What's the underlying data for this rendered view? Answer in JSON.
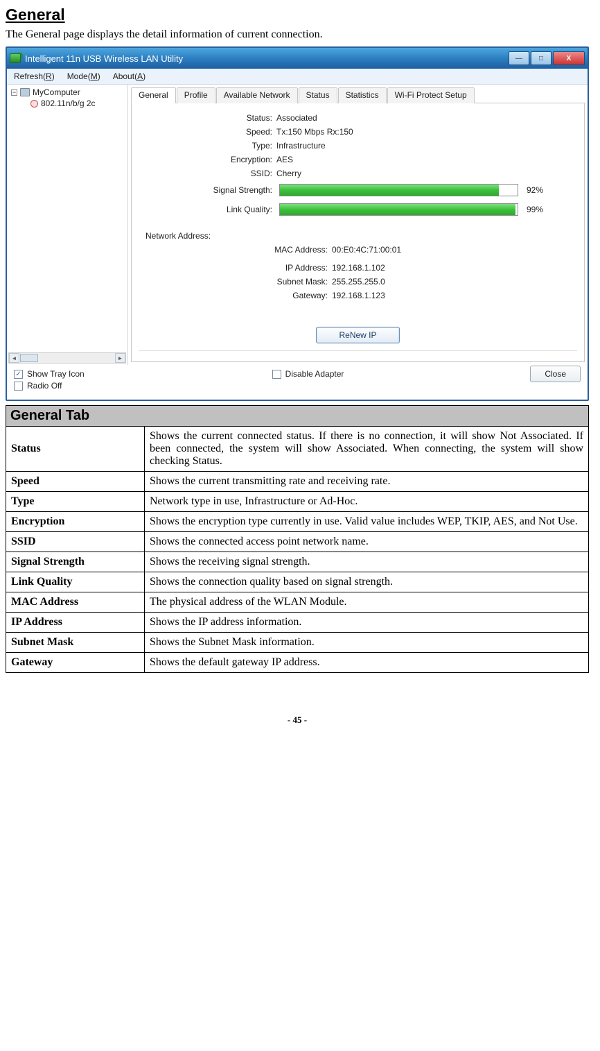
{
  "page": {
    "title": "General",
    "intro": "The General page displays the detail information of current connection.",
    "page_number": "- 45 -"
  },
  "window": {
    "title": "Intelligent 11n USB Wireless LAN Utility",
    "minimize_glyph": "—",
    "maximize_glyph": "□",
    "close_glyph": "X"
  },
  "menu": {
    "refresh": "Refresh(R)",
    "mode": "Mode(M)",
    "about": "About(A)"
  },
  "tree": {
    "root": "MyComputer",
    "child": "802.11n/b/g 2c",
    "toggle": "−"
  },
  "tabs": {
    "general": "General",
    "profile": "Profile",
    "available": "Available Network",
    "status": "Status",
    "statistics": "Statistics",
    "wps": "Wi-Fi Protect Setup"
  },
  "conn": {
    "status_label": "Status:",
    "status_value": "Associated",
    "speed_label": "Speed:",
    "speed_value": "Tx:150 Mbps Rx:150",
    "type_label": "Type:",
    "type_value": "Infrastructure",
    "encryption_label": "Encryption:",
    "encryption_value": "AES",
    "ssid_label": "SSID:",
    "ssid_value": "Cherry",
    "signal_label": "Signal Strength:",
    "signal_pct": "92%",
    "link_label": "Link Quality:",
    "link_pct": "99%"
  },
  "netaddr": {
    "section": "Network Address:",
    "mac_label": "MAC Address:",
    "mac_value": "00:E0:4C:71:00:01",
    "ip_label": "IP Address:",
    "ip_value": "192.168.1.102",
    "mask_label": "Subnet Mask:",
    "mask_value": "255.255.255.0",
    "gw_label": "Gateway:",
    "gw_value": "192.168.1.123"
  },
  "buttons": {
    "renew": "ReNew IP",
    "close": "Close"
  },
  "checks": {
    "show_tray": "Show Tray Icon",
    "radio_off": "Radio Off",
    "disable_adapter": "Disable Adapter",
    "check_glyph": "✓"
  },
  "doc": {
    "header": "General Tab",
    "rows": [
      {
        "k": "Status",
        "d": "Shows the current connected status. If there is no connection, it will show Not Associated. If been connected, the system will show Associated. When connecting, the system will show checking Status."
      },
      {
        "k": "Speed",
        "d": "Shows the current transmitting rate and receiving rate."
      },
      {
        "k": "Type",
        "d": "Network type in use, Infrastructure or Ad-Hoc."
      },
      {
        "k": "Encryption",
        "d": "Shows the encryption type currently in use. Valid value includes WEP, TKIP, AES, and Not Use."
      },
      {
        "k": "SSID",
        "d": "Shows the connected access point network name."
      },
      {
        "k": "Signal Strength",
        "d": "Shows the receiving signal strength."
      },
      {
        "k": "Link Quality",
        "d": "Shows the connection quality based on signal strength."
      },
      {
        "k": "MAC Address",
        "d": "The physical address of the WLAN Module."
      },
      {
        "k": "IP Address",
        "d": "Shows the IP address information."
      },
      {
        "k": "Subnet Mask",
        "d": "Shows the Subnet Mask information."
      },
      {
        "k": "Gateway",
        "d": "Shows the default gateway IP address."
      }
    ]
  },
  "chart_data": {
    "type": "bar",
    "categories": [
      "Signal Strength",
      "Link Quality"
    ],
    "values": [
      92,
      99
    ],
    "ylim": [
      0,
      100
    ],
    "ylabel": "%"
  }
}
